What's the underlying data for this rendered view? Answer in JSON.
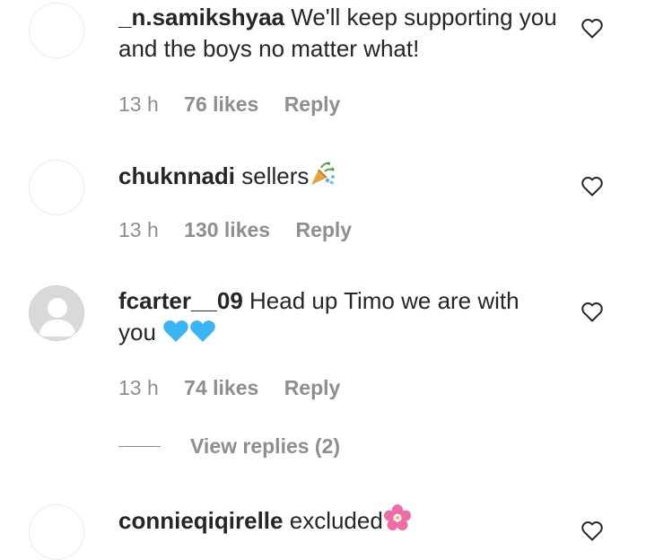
{
  "comments": [
    {
      "username": "_n.samikshyaa",
      "text": "We'll keep supporting you and the boys no matter what!",
      "time": "13 h",
      "likes": "76 likes",
      "reply": "Reply"
    },
    {
      "username": "chuknnadi",
      "text": "sellers",
      "emoji": "confetti-ball-icon",
      "time": "13 h",
      "likes": "130 likes",
      "reply": "Reply"
    },
    {
      "username": "fcarter__09",
      "text": "Head up Timo we are with you",
      "emoji": "blue-heart-icon",
      "time": "13 h",
      "likes": "74 likes",
      "reply": "Reply"
    },
    {
      "username": "connieqiqirelle",
      "text": "excluded",
      "emoji": "cherry-blossom-icon"
    }
  ],
  "view_replies": "View replies (2)",
  "colors": {
    "text": "#262626",
    "muted": "#8e8e8e",
    "blue_heart": "#3ab4f2",
    "blossom": "#f06ca8"
  }
}
